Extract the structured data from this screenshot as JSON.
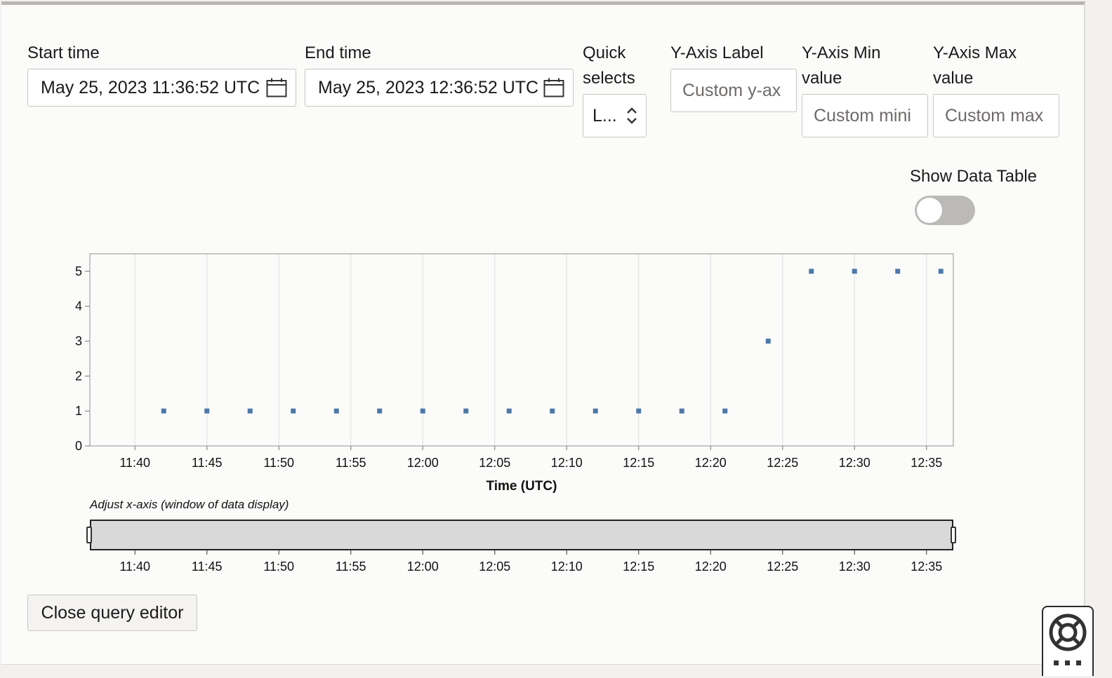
{
  "time_range": {
    "start_label": "Start time",
    "start_value": "May 25, 2023 11:36:52 UTC",
    "end_label": "End time",
    "end_value": "May 25, 2023 12:36:52 UTC",
    "calendar_icon": "calendar-icon"
  },
  "quick_selects": {
    "label": "Quick selects",
    "value": "L...",
    "icon": "updown-chevron-icon"
  },
  "y_axis": {
    "label_title": "Y-Axis Label",
    "label_placeholder": "Custom y-ax",
    "min_title": "Y-Axis Min value",
    "min_placeholder": "Custom mini",
    "max_title": "Y-Axis Max value",
    "max_placeholder": "Custom max"
  },
  "data_table_toggle": {
    "label": "Show Data Table",
    "on": false
  },
  "chart_data": {
    "type": "scatter",
    "title": "",
    "xlabel": "Time (UTC)",
    "ylabel": "",
    "x_ticks": [
      "11:40",
      "11:45",
      "11:50",
      "11:55",
      "12:00",
      "12:05",
      "12:10",
      "12:15",
      "12:20",
      "12:25",
      "12:30",
      "12:35"
    ],
    "y_ticks": [
      "0",
      "1",
      "2",
      "3",
      "4",
      "5"
    ],
    "xlim": [
      "11:36:52",
      "12:36:52"
    ],
    "ylim": [
      0,
      5.5
    ],
    "grid": "vertical",
    "color": "#4c78a8",
    "points": [
      {
        "x": "11:42",
        "y": 1
      },
      {
        "x": "11:45",
        "y": 1
      },
      {
        "x": "11:48",
        "y": 1
      },
      {
        "x": "11:51",
        "y": 1
      },
      {
        "x": "11:54",
        "y": 1
      },
      {
        "x": "11:57",
        "y": 1
      },
      {
        "x": "12:00",
        "y": 1
      },
      {
        "x": "12:03",
        "y": 1
      },
      {
        "x": "12:06",
        "y": 1
      },
      {
        "x": "12:09",
        "y": 1
      },
      {
        "x": "12:12",
        "y": 1
      },
      {
        "x": "12:15",
        "y": 1
      },
      {
        "x": "12:18",
        "y": 1
      },
      {
        "x": "12:21",
        "y": 1
      },
      {
        "x": "12:24",
        "y": 3
      },
      {
        "x": "12:27",
        "y": 5
      },
      {
        "x": "12:30",
        "y": 5
      },
      {
        "x": "12:33",
        "y": 5
      },
      {
        "x": "12:36",
        "y": 5
      }
    ]
  },
  "brush": {
    "caption": "Adjust x-axis (window of data display)",
    "x_ticks": [
      "11:40",
      "11:45",
      "11:50",
      "11:55",
      "12:00",
      "12:05",
      "12:10",
      "12:15",
      "12:20",
      "12:25",
      "12:30",
      "12:35"
    ]
  },
  "footer": {
    "close_label": "Close query editor",
    "help_icon": "lifebuoy-icon"
  }
}
